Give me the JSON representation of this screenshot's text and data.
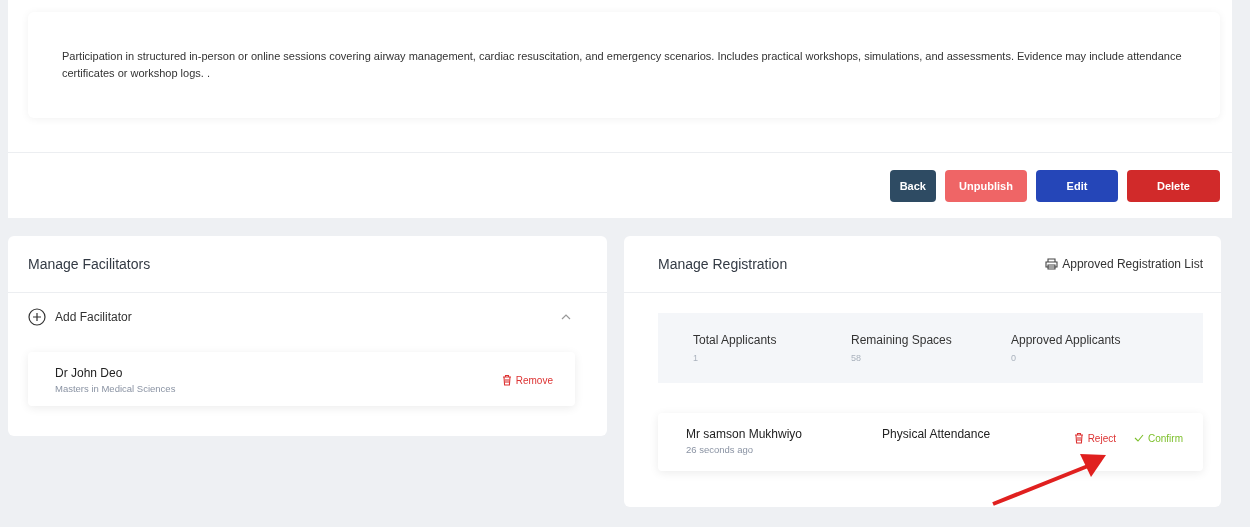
{
  "description": "Participation in structured in-person or online sessions covering airway management, cardiac resuscitation, and emergency scenarios. Includes practical workshops, simulations, and assessments. Evidence may include attendance certificates or workshop logs. .",
  "buttons": [
    {
      "label": "Back",
      "kind": "back"
    },
    {
      "label": "Unpublish",
      "kind": "unpublish"
    },
    {
      "label": "Edit",
      "kind": "edit"
    },
    {
      "label": "Delete",
      "kind": "delete"
    }
  ],
  "facilitators": {
    "title": "Manage Facilitators",
    "add_label": "Add Facilitator",
    "expanded": true,
    "items": [
      {
        "name": "Dr John Deo",
        "qualification": "Masters in Medical Sciences",
        "action": "Remove"
      }
    ]
  },
  "registration": {
    "title": "Manage Registration",
    "list_link": "Approved Registration List",
    "stats": [
      {
        "label": "Total Applicants",
        "value": "1"
      },
      {
        "label": "Remaining Spaces",
        "value": "58"
      },
      {
        "label": "Approved Applicants",
        "value": "0"
      }
    ],
    "applicants": [
      {
        "name": "Mr samson Mukhwiyo",
        "time": "26 seconds ago",
        "attendance": "Physical Attendance",
        "reject": "Reject",
        "confirm": "Confirm"
      }
    ]
  }
}
